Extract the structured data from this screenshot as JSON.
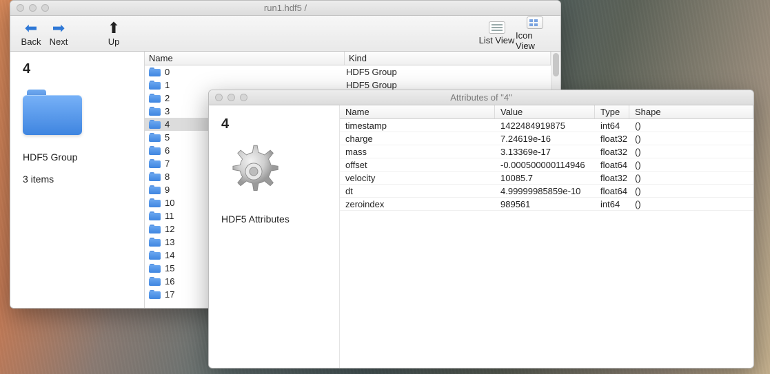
{
  "browser_window": {
    "title": "run1.hdf5 /",
    "toolbar": {
      "back": "Back",
      "next": "Next",
      "up": "Up",
      "list_view": "List View",
      "icon_view": "Icon View"
    },
    "sidebar": {
      "title": "4",
      "kind": "HDF5 Group",
      "count": "3 items"
    },
    "columns": {
      "name": "Name",
      "kind": "Kind"
    },
    "selected_index": 4,
    "items": [
      {
        "name": "0",
        "kind": "HDF5 Group"
      },
      {
        "name": "1",
        "kind": "HDF5 Group"
      },
      {
        "name": "2",
        "kind": ""
      },
      {
        "name": "3",
        "kind": ""
      },
      {
        "name": "4",
        "kind": ""
      },
      {
        "name": "5",
        "kind": ""
      },
      {
        "name": "6",
        "kind": ""
      },
      {
        "name": "7",
        "kind": ""
      },
      {
        "name": "8",
        "kind": ""
      },
      {
        "name": "9",
        "kind": ""
      },
      {
        "name": "10",
        "kind": ""
      },
      {
        "name": "11",
        "kind": ""
      },
      {
        "name": "12",
        "kind": ""
      },
      {
        "name": "13",
        "kind": ""
      },
      {
        "name": "14",
        "kind": ""
      },
      {
        "name": "15",
        "kind": ""
      },
      {
        "name": "16",
        "kind": ""
      },
      {
        "name": "17",
        "kind": ""
      }
    ]
  },
  "attr_window": {
    "title": "Attributes of \"4\"",
    "sidebar": {
      "title": "4",
      "kind": "HDF5 Attributes"
    },
    "columns": {
      "name": "Name",
      "value": "Value",
      "type": "Type",
      "shape": "Shape"
    },
    "rows": [
      {
        "name": "timestamp",
        "value": "1422484919875",
        "type": "int64",
        "shape": "()"
      },
      {
        "name": "charge",
        "value": "7.24619e-16",
        "type": "float32",
        "shape": "()"
      },
      {
        "name": "mass",
        "value": "3.13369e-17",
        "type": "float32",
        "shape": "()"
      },
      {
        "name": "offset",
        "value": "-0.000500000114946",
        "type": "float64",
        "shape": "()"
      },
      {
        "name": "velocity",
        "value": "10085.7",
        "type": "float32",
        "shape": "()"
      },
      {
        "name": "dt",
        "value": "4.99999985859e-10",
        "type": "float64",
        "shape": "()"
      },
      {
        "name": "zeroindex",
        "value": "989561",
        "type": "int64",
        "shape": "()"
      }
    ]
  }
}
